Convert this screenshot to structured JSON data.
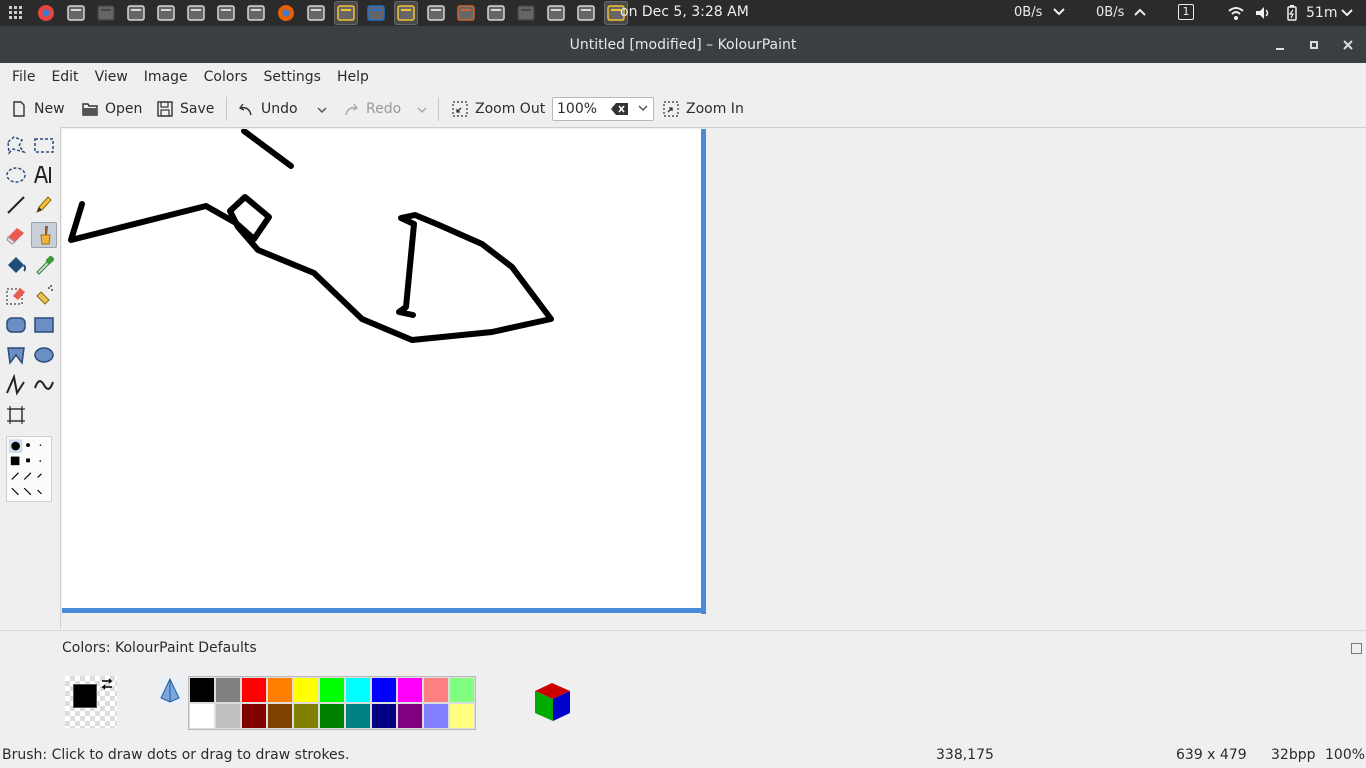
{
  "panel": {
    "clock": "on Dec  5, 3:28 AM",
    "net_down": "0B/s",
    "net_up": "0B/s",
    "workspace": "1",
    "battery": "51m",
    "launchers": [
      "grid-icon",
      "chrome-icon",
      "files-icon",
      "terminal-icon",
      "scissors-icon",
      "text-editor-icon",
      "system-monitor-icon",
      "calculator-icon",
      "disk-icon",
      "firefox-icon",
      "settings-icon",
      "kolourpaint-icon",
      "display-icon",
      "kolourpaint-icon",
      "window-icon",
      "paint-brushes-icon",
      "window-icon",
      "terminal-icon",
      "window-icon",
      "window-icon",
      "kolourpaint-icon"
    ]
  },
  "window": {
    "title": "Untitled [modified] – KolourPaint"
  },
  "menu": [
    "File",
    "Edit",
    "View",
    "Image",
    "Colors",
    "Settings",
    "Help"
  ],
  "toolbar": {
    "new_label": "New",
    "open_label": "Open",
    "save_label": "Save",
    "undo_label": "Undo",
    "redo_label": "Redo",
    "zoom_out_label": "Zoom Out",
    "zoom_value": "100%",
    "zoom_in_label": "Zoom In"
  },
  "colorbox": {
    "label": "Colors: KolourPaint Defaults",
    "foreground": "#000000",
    "palette_top": [
      "#000000",
      "#808080",
      "#ff0000",
      "#ff8000",
      "#ffff00",
      "#00ff00",
      "#00ffff",
      "#0000ff",
      "#ff00ff",
      "#ff8080",
      "#80ff80"
    ],
    "palette_bottom": [
      "#ffffff",
      "#c0c0c0",
      "#800000",
      "#804000",
      "#808000",
      "#008000",
      "#008080",
      "#000080",
      "#800080",
      "#8080ff",
      "#ffff80"
    ]
  },
  "status": {
    "message": "Brush: Click to draw dots or drag to draw strokes.",
    "coords": "338,175",
    "size": "639 x 479",
    "bpp": "32bpp",
    "zoom": "100%"
  },
  "colors": {
    "accent": "#4a8ad8",
    "panel_bg": "#2b2b2b",
    "titlebar_bg": "#3b3e42"
  }
}
